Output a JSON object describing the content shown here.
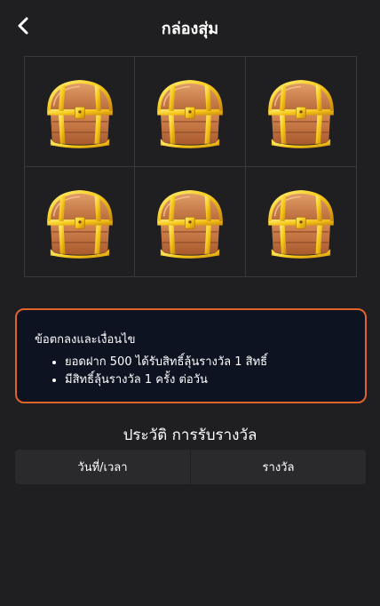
{
  "header": {
    "title": "กล่องสุ่ม",
    "back_icon": "chevron-left-icon"
  },
  "chests": [
    {
      "icon": "treasure-chest-icon"
    },
    {
      "icon": "treasure-chest-icon"
    },
    {
      "icon": "treasure-chest-icon"
    },
    {
      "icon": "treasure-chest-icon"
    },
    {
      "icon": "treasure-chest-icon"
    },
    {
      "icon": "treasure-chest-icon"
    }
  ],
  "terms": {
    "title": "ข้อตกลงและเงื่อนไข",
    "items": [
      "ยอดฝาก 500 ได้รับสิทธิ์ลุ้นรางวัล 1 สิทธิ์",
      "มีสิทธิ์ลุ้นรางวัล 1 ครั้ง ต่อวัน"
    ],
    "border_color": "#e0632b"
  },
  "history": {
    "title": "ประวัติ การรับรางวัล",
    "columns": [
      "วันที่/เวลา",
      "รางวัล"
    ]
  }
}
